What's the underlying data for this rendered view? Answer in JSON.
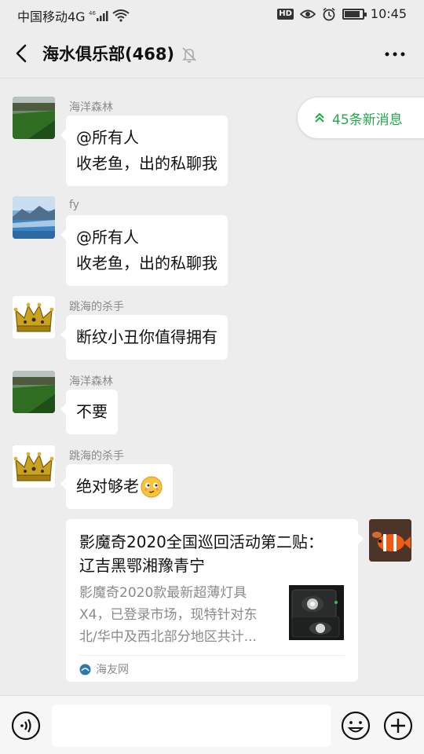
{
  "status_bar": {
    "carrier": "中国移动4G",
    "network": "4G",
    "hd_badge": "HD",
    "time": "10:45",
    "battery_level": 0.8
  },
  "header": {
    "title": "海水俱乐部(468)",
    "back_icon": "chevron-left-icon",
    "mute_icon": "bell-off-icon",
    "more_icon": "more-dots-icon"
  },
  "new_messages": {
    "label": "45条新消息",
    "icon": "double-chevron-up-icon",
    "color": "#22a94b"
  },
  "messages": [
    {
      "sender": "海洋森林",
      "lines": [
        "@所有人",
        "收老鱼，出的私聊我"
      ],
      "avatar": "grass-landscape-avatar"
    },
    {
      "sender": "fy",
      "lines": [
        "@所有人",
        "收老鱼，出的私聊我"
      ],
      "avatar": "lake-mountain-avatar"
    },
    {
      "sender": "跳海的杀手",
      "lines": [
        "断纹小丑你值得拥有"
      ],
      "avatar": "crown-avatar"
    },
    {
      "sender": "海洋森林",
      "lines": [
        "不要"
      ],
      "avatar": "grass-landscape-avatar"
    },
    {
      "sender": "跳海的杀手",
      "lines": [
        "绝对够老"
      ],
      "emoji": "smirk-emoji",
      "avatar": "crown-avatar"
    }
  ],
  "link_card": {
    "title": "影魔奇2020全国巡回活动第二贴： 辽吉黑鄂湘豫青宁",
    "desc_lines": [
      "影魔奇2020款最新超薄灯具",
      "X4，已登录市场，现特针对东",
      "北/华中及西北部分地区共计..."
    ],
    "source": "海友网",
    "sender_avatar": "clownfish-avatar"
  },
  "input_bar": {
    "voice_icon": "voice-icon",
    "input_value": "",
    "emoji_icon": "emoji-icon",
    "plus_icon": "plus-icon"
  }
}
